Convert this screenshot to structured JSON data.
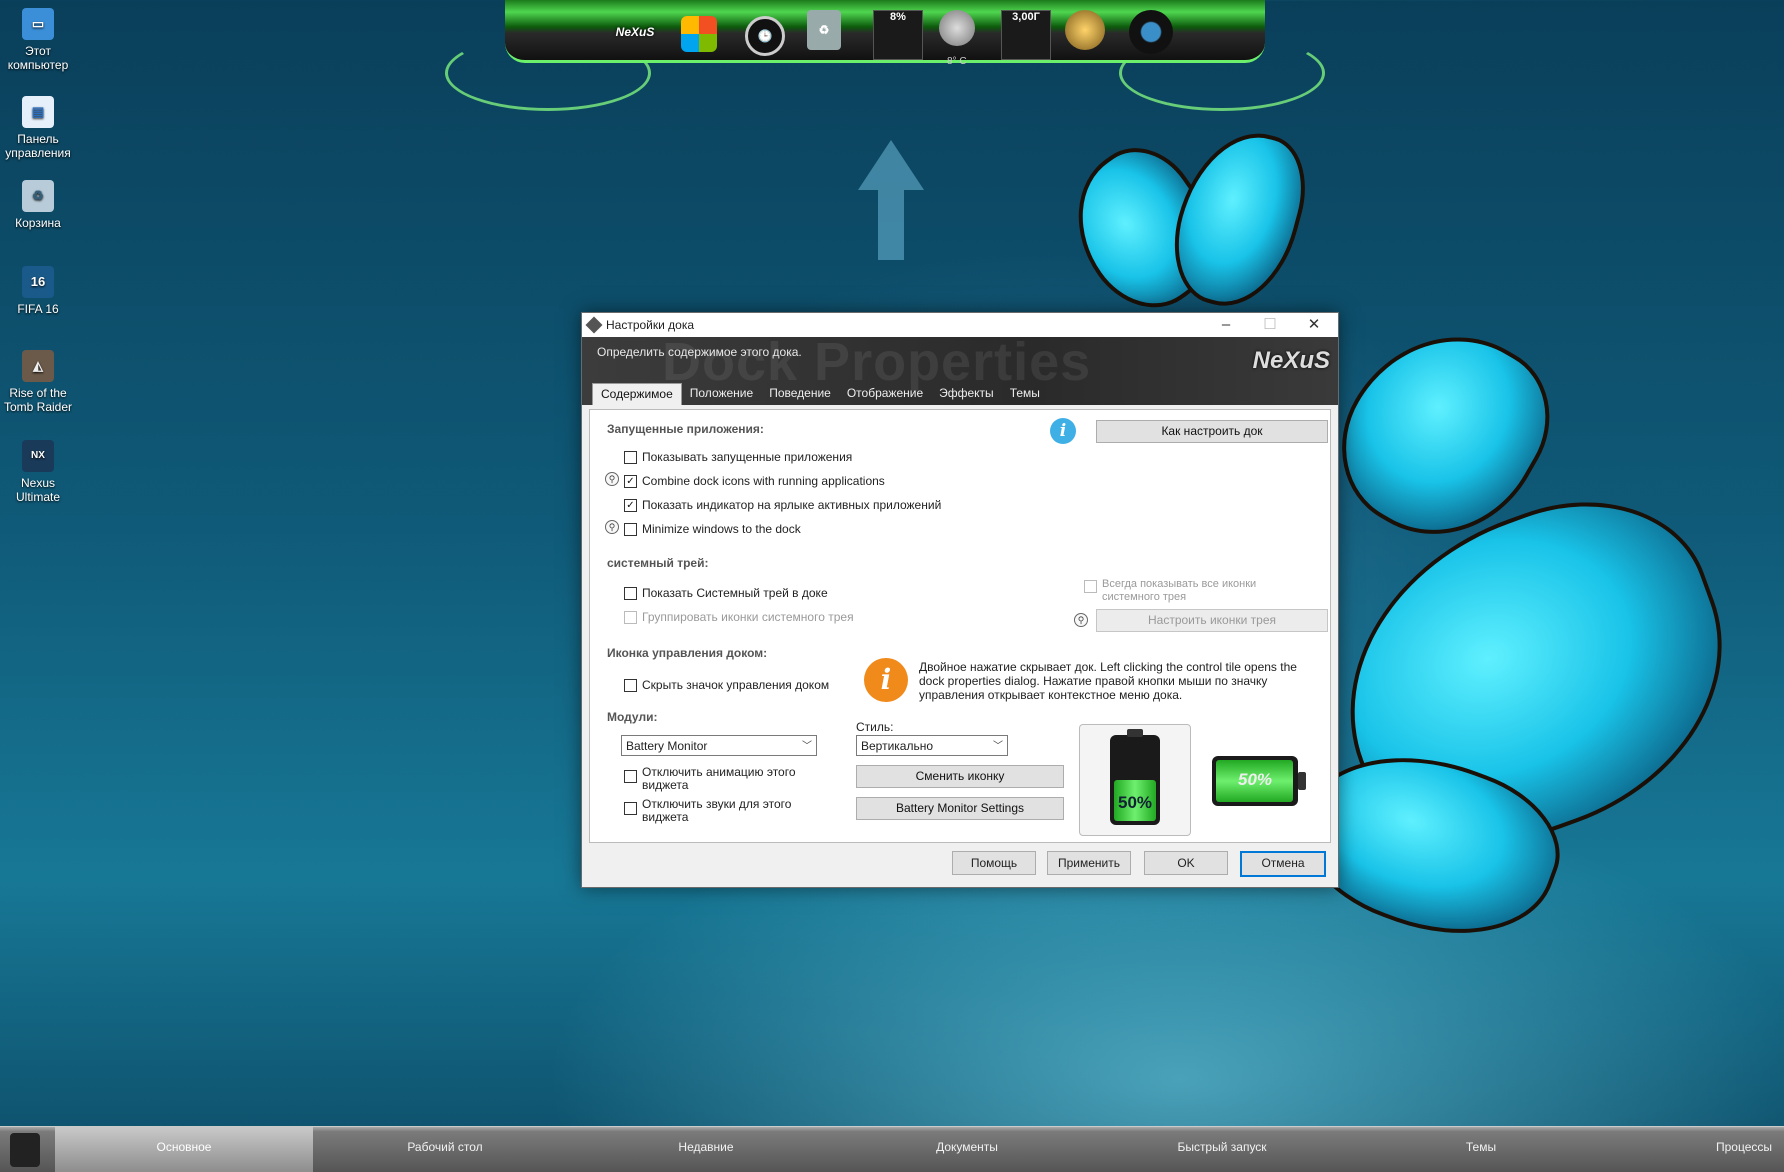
{
  "desktop": {
    "icons": [
      {
        "label": "Этот компьютер",
        "icon": "computer-icon"
      },
      {
        "label": "Панель управления",
        "icon": "control-panel-icon"
      },
      {
        "label": "Корзина",
        "icon": "recycle-bin-icon"
      },
      {
        "label": "FIFA 16",
        "icon": "fifa-icon"
      },
      {
        "label": "Rise of the Tomb Raider",
        "icon": "tomb-raider-icon"
      },
      {
        "label": "Nexus Ultimate",
        "icon": "nexus-icon"
      }
    ]
  },
  "topdock": {
    "logo": "NeXuS",
    "cpu": "8%",
    "ram": "3,00Г",
    "weather_temp": "8° C"
  },
  "dialog": {
    "title": "Настройки дока",
    "description": "Определить содержимое этого дока.",
    "header_ghost": "Dock Properties",
    "logo": "NeXuS",
    "tabs": [
      "Содержимое",
      "Положение",
      "Поведение",
      "Отображение",
      "Эффекты",
      "Темы"
    ],
    "running": {
      "heading": "Запущенные приложения:",
      "how_button": "Как настроить док",
      "show_running": "Показывать запущенные приложения",
      "combine": "Combine dock icons with running applications",
      "show_indicator": "Показать индикатор на ярлыке активных приложений",
      "minimize": "Minimize windows to the dock"
    },
    "tray": {
      "heading": "системный трей:",
      "show_tray": "Показать Системный трей в доке",
      "group_icons": "Группировать иконки системного трея",
      "always_show": "Всегда показывать все иконки системного трея",
      "configure_button": "Настроить иконки трея"
    },
    "control": {
      "heading": "Иконка управления доком:",
      "hide_icon": "Скрыть значок управления доком",
      "info": "Двойное нажатие скрывает док. Left clicking the control tile opens the dock properties dialog. Нажатие правой кнопки мыши по значку управления открывает контекстное меню дока."
    },
    "modules": {
      "heading": "Модули:",
      "selected_module": "Battery Monitor",
      "style_label": "Стиль:",
      "style_value": "Вертикально",
      "disable_animation": "Отключить анимацию этого виджета",
      "disable_sounds": "Отключить звуки для этого виджета",
      "change_icon_button": "Сменить иконку",
      "settings_button": "Battery Monitor Settings",
      "battery_level": 50,
      "battery_label": "50%"
    },
    "footer": {
      "help": "Помощь",
      "apply": "Применить",
      "ok": "OK",
      "cancel": "Отмена"
    }
  },
  "taskbar": {
    "items": [
      "Основное",
      "Рабочий стол",
      "Недавние",
      "Документы",
      "Быстрый запуск",
      "Темы",
      "Процессы"
    ]
  }
}
